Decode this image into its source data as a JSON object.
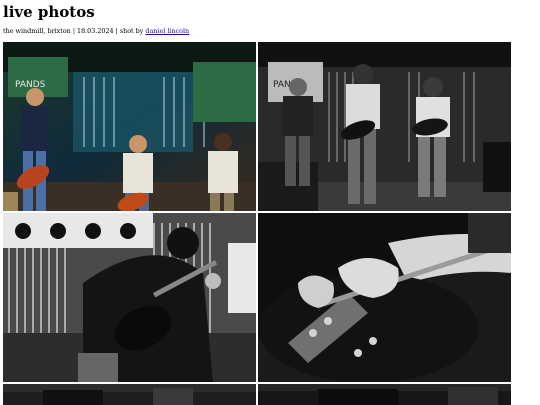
{
  "page": {
    "title": "live photos",
    "subtitle_prefix": "the windmill, brixton | 18.03.2024 | shot by ",
    "photographer_link": "daniel lincoln"
  },
  "photos": [
    {
      "kind": "colour",
      "description_icon": "band-photo"
    },
    {
      "kind": "black-and-white",
      "description_icon": "band-photo"
    },
    {
      "kind": "black-and-white",
      "description_icon": "guitarist-photo"
    },
    {
      "kind": "black-and-white",
      "description_icon": "guitar-closeup-photo"
    },
    {
      "kind": "black-and-white",
      "description_icon": "band-photo"
    },
    {
      "kind": "black-and-white",
      "description_icon": "band-photo"
    }
  ],
  "colors": {
    "link": "#1a0dab",
    "background": "#ffffff"
  }
}
